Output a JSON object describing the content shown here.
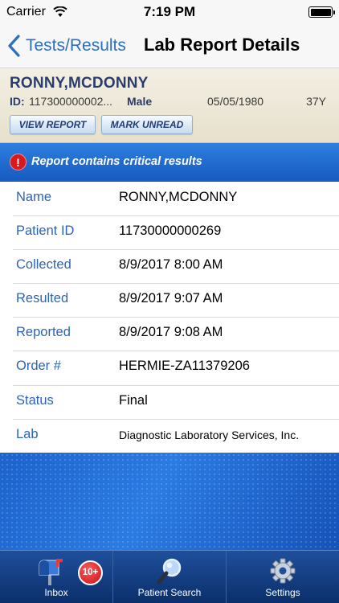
{
  "status_bar": {
    "carrier": "Carrier",
    "time": "7:19 PM"
  },
  "nav": {
    "back_label": "Tests/Results",
    "title": "Lab Report Details"
  },
  "patient": {
    "name": "RONNY,MCDONNY",
    "id_label": "ID:",
    "id_value": "117300000002...",
    "sex": "Male",
    "dob": "05/05/1980",
    "age": "37Y",
    "view_report_label": "VIEW REPORT",
    "mark_unread_label": "MARK UNREAD"
  },
  "alert": {
    "text": "Report contains critical results",
    "icon": "!"
  },
  "details": [
    {
      "label": "Name",
      "value": "RONNY,MCDONNY"
    },
    {
      "label": "Patient ID",
      "value": "11730000000269"
    },
    {
      "label": "Collected",
      "value": "8/9/2017 8:00 AM"
    },
    {
      "label": "Resulted",
      "value": "8/9/2017 9:07 AM"
    },
    {
      "label": "Reported",
      "value": "8/9/2017 9:08 AM"
    },
    {
      "label": "Order #",
      "value": "HERMIE-ZA11379206"
    },
    {
      "label": "Status",
      "value": "Final"
    },
    {
      "label": "Lab",
      "value": "Diagnostic Laboratory Services, Inc."
    }
  ],
  "tab_bar": {
    "tabs": [
      {
        "label": "Inbox",
        "icon": "mailbox-icon",
        "badge": "10+"
      },
      {
        "label": "Patient Search",
        "icon": "magnifier-icon"
      },
      {
        "label": "Settings",
        "icon": "gear-icon"
      }
    ]
  },
  "colors": {
    "accent": "#2e64b6",
    "banner": "#1f6ad3",
    "tab_bar": "#0b2f6a",
    "badge": "#d8191f"
  }
}
